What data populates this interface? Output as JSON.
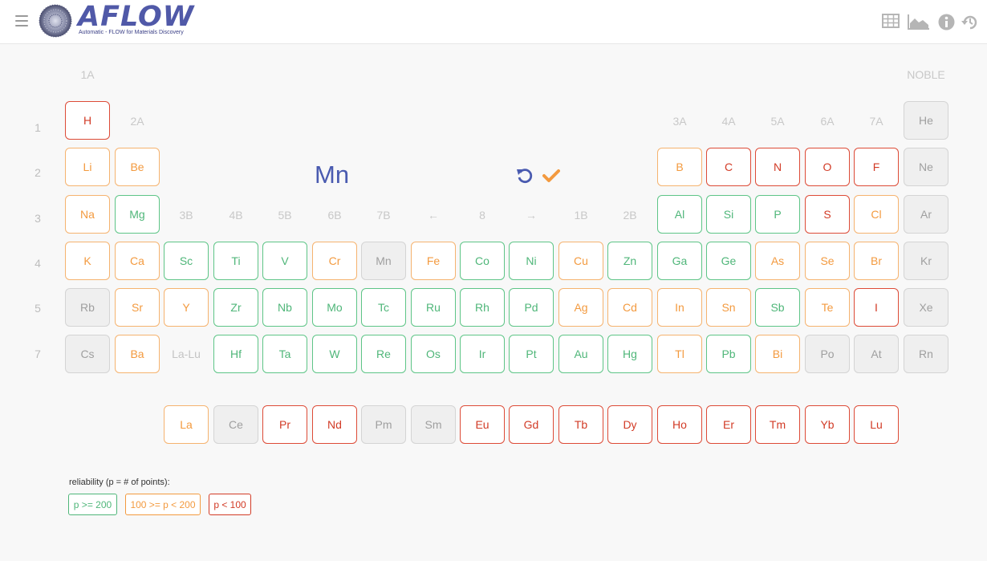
{
  "header": {
    "logo_word": "AFLOW",
    "logo_tagline": "Automatic - FLOW for Materials Discovery",
    "icons": [
      "menu-icon",
      "table-icon",
      "area-chart-icon",
      "info-icon",
      "history-icon"
    ]
  },
  "colors": {
    "green": "#4fb679",
    "orange": "#f39a3f",
    "red": "#d23b26",
    "gray": "#9f9f9f",
    "accent": "#4a5bb0"
  },
  "group_labels": [
    "1A",
    "NOBLE",
    "2A",
    "3A",
    "4A",
    "5A",
    "6A",
    "7A",
    "3B",
    "4B",
    "5B",
    "6B",
    "7B",
    "←",
    "8",
    "→",
    "1B",
    "2B"
  ],
  "row_labels": [
    "1",
    "2",
    "3",
    "4",
    "5",
    "7"
  ],
  "selection": {
    "symbol": "Mn"
  },
  "elements": [
    {
      "sym": "H",
      "status": "red"
    },
    {
      "sym": "He",
      "status": "gray"
    },
    {
      "sym": "Li",
      "status": "orange"
    },
    {
      "sym": "Be",
      "status": "orange"
    },
    {
      "sym": "B",
      "status": "orange"
    },
    {
      "sym": "C",
      "status": "red"
    },
    {
      "sym": "N",
      "status": "red"
    },
    {
      "sym": "O",
      "status": "red"
    },
    {
      "sym": "F",
      "status": "red"
    },
    {
      "sym": "Ne",
      "status": "gray"
    },
    {
      "sym": "Na",
      "status": "orange"
    },
    {
      "sym": "Mg",
      "status": "green"
    },
    {
      "sym": "Al",
      "status": "green"
    },
    {
      "sym": "Si",
      "status": "green"
    },
    {
      "sym": "P",
      "status": "green"
    },
    {
      "sym": "S",
      "status": "red"
    },
    {
      "sym": "Cl",
      "status": "orange"
    },
    {
      "sym": "Ar",
      "status": "gray"
    },
    {
      "sym": "K",
      "status": "orange"
    },
    {
      "sym": "Ca",
      "status": "orange"
    },
    {
      "sym": "Sc",
      "status": "green"
    },
    {
      "sym": "Ti",
      "status": "green"
    },
    {
      "sym": "V",
      "status": "green"
    },
    {
      "sym": "Cr",
      "status": "orange"
    },
    {
      "sym": "Mn",
      "status": "gray"
    },
    {
      "sym": "Fe",
      "status": "orange"
    },
    {
      "sym": "Co",
      "status": "green"
    },
    {
      "sym": "Ni",
      "status": "green"
    },
    {
      "sym": "Cu",
      "status": "orange"
    },
    {
      "sym": "Zn",
      "status": "green"
    },
    {
      "sym": "Ga",
      "status": "green"
    },
    {
      "sym": "Ge",
      "status": "green"
    },
    {
      "sym": "As",
      "status": "orange"
    },
    {
      "sym": "Se",
      "status": "orange"
    },
    {
      "sym": "Br",
      "status": "orange"
    },
    {
      "sym": "Kr",
      "status": "gray"
    },
    {
      "sym": "Rb",
      "status": "gray"
    },
    {
      "sym": "Sr",
      "status": "orange"
    },
    {
      "sym": "Y",
      "status": "orange"
    },
    {
      "sym": "Zr",
      "status": "green"
    },
    {
      "sym": "Nb",
      "status": "green"
    },
    {
      "sym": "Mo",
      "status": "green"
    },
    {
      "sym": "Tc",
      "status": "green"
    },
    {
      "sym": "Ru",
      "status": "green"
    },
    {
      "sym": "Rh",
      "status": "green"
    },
    {
      "sym": "Pd",
      "status": "green"
    },
    {
      "sym": "Ag",
      "status": "orange"
    },
    {
      "sym": "Cd",
      "status": "orange"
    },
    {
      "sym": "In",
      "status": "orange"
    },
    {
      "sym": "Sn",
      "status": "orange"
    },
    {
      "sym": "Sb",
      "status": "green"
    },
    {
      "sym": "Te",
      "status": "orange"
    },
    {
      "sym": "I",
      "status": "red"
    },
    {
      "sym": "Xe",
      "status": "gray"
    },
    {
      "sym": "Cs",
      "status": "gray"
    },
    {
      "sym": "Ba",
      "status": "orange"
    },
    {
      "sym": "La-Lu",
      "status": "plain"
    },
    {
      "sym": "Hf",
      "status": "green"
    },
    {
      "sym": "Ta",
      "status": "green"
    },
    {
      "sym": "W",
      "status": "green"
    },
    {
      "sym": "Re",
      "status": "green"
    },
    {
      "sym": "Os",
      "status": "green"
    },
    {
      "sym": "Ir",
      "status": "green"
    },
    {
      "sym": "Pt",
      "status": "green"
    },
    {
      "sym": "Au",
      "status": "green"
    },
    {
      "sym": "Hg",
      "status": "green"
    },
    {
      "sym": "Tl",
      "status": "orange"
    },
    {
      "sym": "Pb",
      "status": "green"
    },
    {
      "sym": "Bi",
      "status": "orange"
    },
    {
      "sym": "Po",
      "status": "gray"
    },
    {
      "sym": "At",
      "status": "gray"
    },
    {
      "sym": "Rn",
      "status": "gray"
    },
    {
      "sym": "La",
      "status": "orange"
    },
    {
      "sym": "Ce",
      "status": "gray"
    },
    {
      "sym": "Pr",
      "status": "red"
    },
    {
      "sym": "Nd",
      "status": "red"
    },
    {
      "sym": "Pm",
      "status": "gray"
    },
    {
      "sym": "Sm",
      "status": "gray"
    },
    {
      "sym": "Eu",
      "status": "red"
    },
    {
      "sym": "Gd",
      "status": "red"
    },
    {
      "sym": "Tb",
      "status": "red"
    },
    {
      "sym": "Dy",
      "status": "red"
    },
    {
      "sym": "Ho",
      "status": "red"
    },
    {
      "sym": "Er",
      "status": "red"
    },
    {
      "sym": "Tm",
      "status": "red"
    },
    {
      "sym": "Yb",
      "status": "red"
    },
    {
      "sym": "Lu",
      "status": "red"
    }
  ],
  "legend": {
    "title": "reliability (p = # of points):",
    "items": [
      {
        "label": "p >= 200",
        "status": "green"
      },
      {
        "label": "100 >= p < 200",
        "status": "orange"
      },
      {
        "label": "p < 100",
        "status": "red"
      }
    ]
  }
}
